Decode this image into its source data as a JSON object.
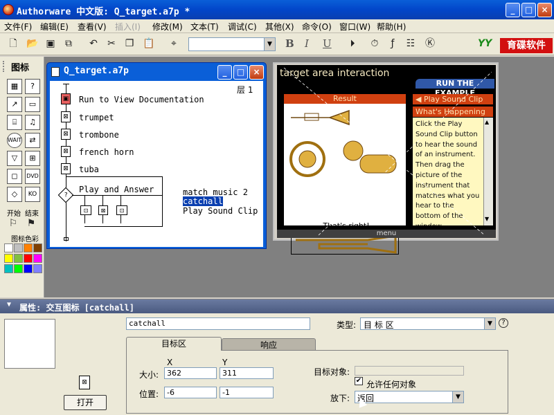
{
  "window": {
    "title": "Authorware 中文版: Q_target.a7p *",
    "min": "_",
    "max": "□",
    "close": "×"
  },
  "menu": [
    "文件(F)",
    "编辑(E)",
    "查看(V)",
    "插入(I)",
    "修改(M)",
    "文本(T)",
    "调试(C)",
    "其他(X)",
    "命令(O)",
    "窗口(W)",
    "帮助(H)"
  ],
  "toolbar": {
    "brand_logo": "YY",
    "brand_text": "育碟软件",
    "bold": "B",
    "italic": "I",
    "underline": "U",
    "font_value": ""
  },
  "palette": {
    "title": "图标",
    "start_label": "开始",
    "end_label": "结束",
    "colors_label": "图标色彩",
    "colors": [
      "#ffffff",
      "#c0c0c0",
      "#ff8000",
      "#804000",
      "#ffff00",
      "#80c040",
      "#ff0000",
      "#ff00ff",
      "#00c0c0",
      "#00ff00",
      "#0000ff",
      "#8080ff"
    ]
  },
  "flow_window": {
    "title": "Q_target.a7p",
    "layer": "层 1",
    "items": [
      "Run to View Documentation",
      "trumpet",
      "trombone",
      "french horn",
      "tuba"
    ],
    "interaction_title": "Play and Answer",
    "branches": [
      "match music 2",
      "catchall",
      "Play Sound Clip"
    ]
  },
  "presentation": {
    "title": "target area interaction",
    "run_example": "RUN THE EXAMPLE",
    "result_tab": "Result",
    "play_tab": "◀ Play Sound Clip",
    "happening_tab": "What's Happening",
    "description": "Click the Play Sound Clip button to hear the sound of an instrument. Then drag the picture of the instrument that matches what you hear to the bottom of the window.",
    "thats_right": "That's right!",
    "menu": "menu"
  },
  "properties": {
    "header": "属性: 交互图标 [catchall]",
    "name": "catchall",
    "type_label": "类型:",
    "type_value": "目 标 区",
    "help": "?",
    "tab_target": "目标区",
    "tab_response": "响应",
    "col_x": "X",
    "col_y": "Y",
    "size_label": "大小:",
    "size_x": "362",
    "size_y": "311",
    "pos_label": "位置:",
    "pos_x": "-6",
    "pos_y": "-1",
    "target_object_label": "目标对象:",
    "allow_any_label": "允许任何对象",
    "allow_any_checked": "✔",
    "drop_label": "放下:",
    "drop_value": "返回",
    "open_button": "打开"
  }
}
